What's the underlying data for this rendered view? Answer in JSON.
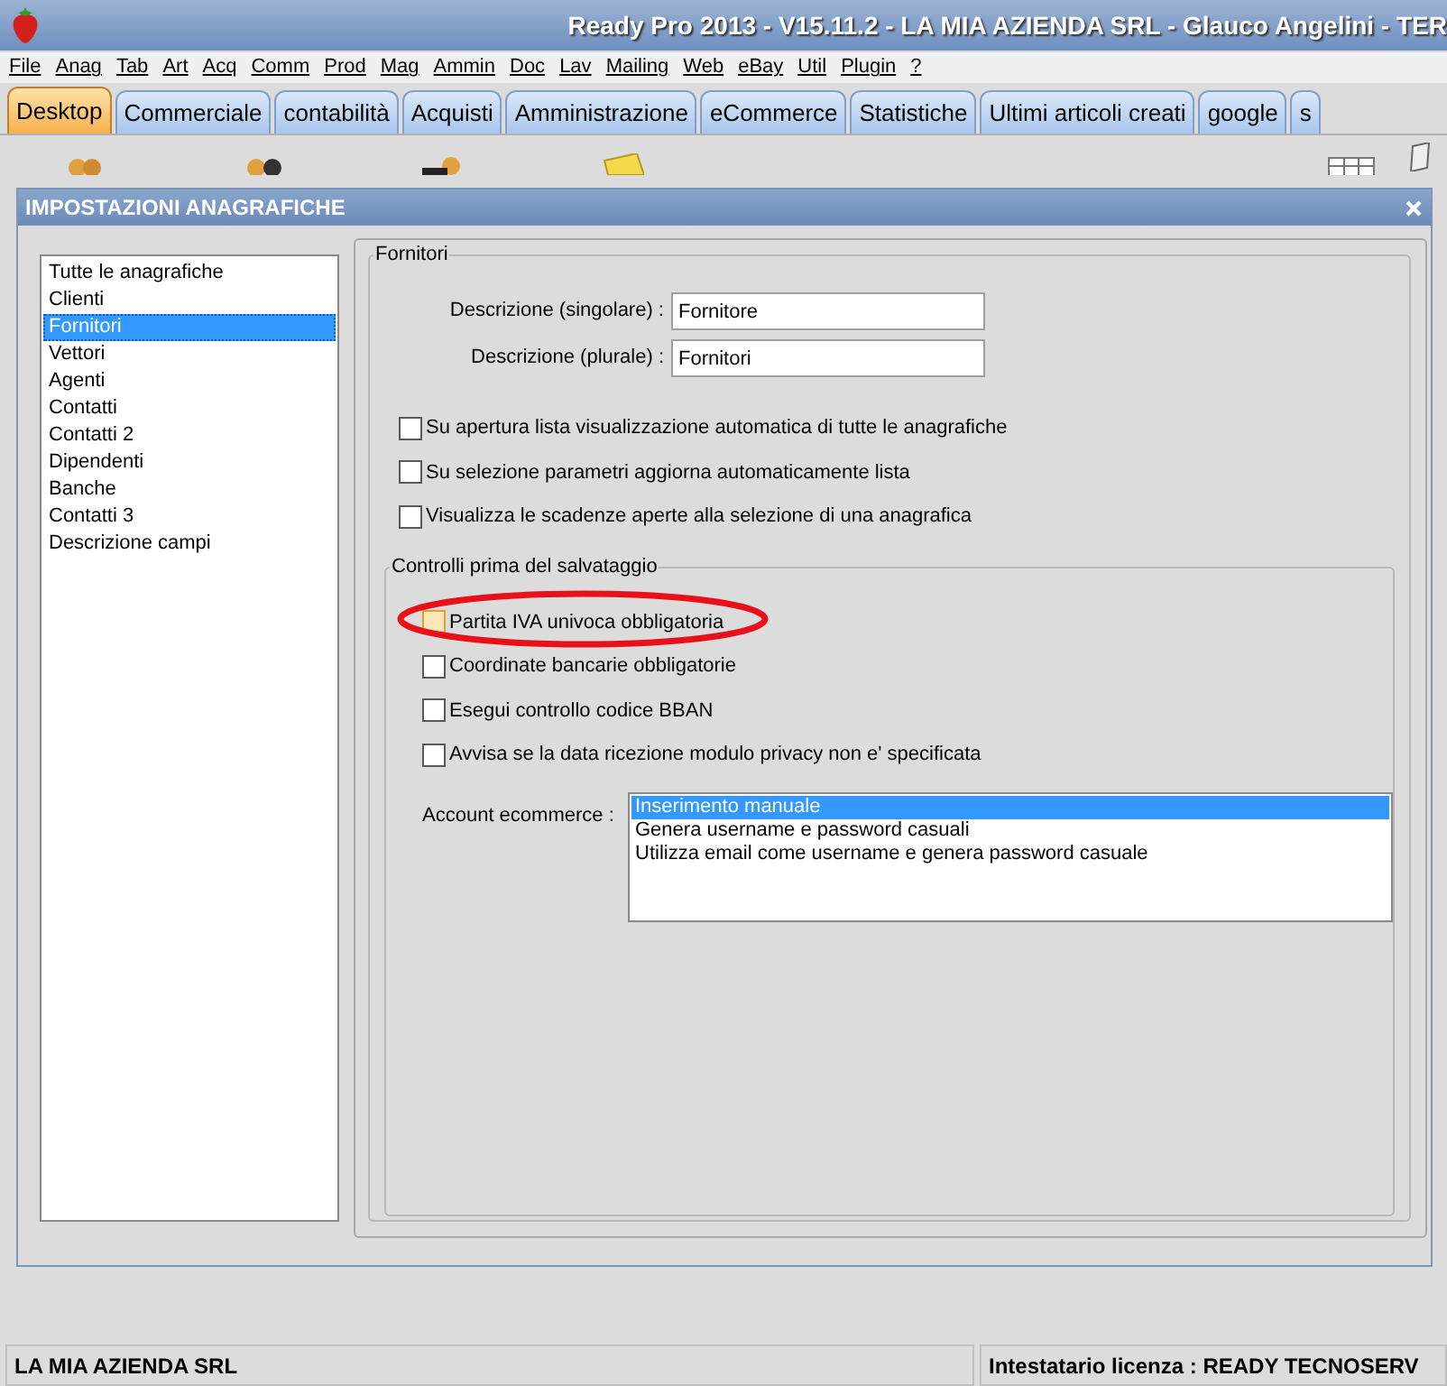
{
  "window": {
    "title": "Ready Pro 2013 - V15.11.2 - LA MIA AZIENDA SRL - Glauco Angelini - TER"
  },
  "menu": [
    "File",
    "Anag",
    "Tab",
    "Art",
    "Acq",
    "Comm",
    "Prod",
    "Mag",
    "Ammin",
    "Doc",
    "Lav",
    "Mailing",
    "Web",
    "eBay",
    "Util",
    "Plugin",
    "?"
  ],
  "tabs": [
    {
      "label": "Desktop",
      "selected": true
    },
    {
      "label": "Commerciale",
      "selected": false
    },
    {
      "label": "contabilità",
      "selected": false
    },
    {
      "label": "Acquisti",
      "selected": false
    },
    {
      "label": "Amministrazione",
      "selected": false
    },
    {
      "label": "eCommerce",
      "selected": false
    },
    {
      "label": "Statistiche",
      "selected": false
    },
    {
      "label": "Ultimi articoli creati",
      "selected": false
    },
    {
      "label": "google",
      "selected": false
    },
    {
      "label": "s",
      "selected": false
    }
  ],
  "dialog": {
    "title": "IMPOSTAZIONI ANAGRAFICHE",
    "list": [
      {
        "label": "Tutte le anagrafiche",
        "selected": false
      },
      {
        "label": "Clienti",
        "selected": false
      },
      {
        "label": "Fornitori",
        "selected": true
      },
      {
        "label": "Vettori",
        "selected": false
      },
      {
        "label": "Agenti",
        "selected": false
      },
      {
        "label": "Contatti",
        "selected": false
      },
      {
        "label": "Contatti 2",
        "selected": false
      },
      {
        "label": "Dipendenti",
        "selected": false
      },
      {
        "label": "Banche",
        "selected": false
      },
      {
        "label": "Contatti 3",
        "selected": false
      },
      {
        "label": "Descrizione campi",
        "selected": false
      }
    ],
    "group": {
      "title": "Fornitori",
      "fields": [
        {
          "label": "Descrizione (singolare) :",
          "value": "Fornitore"
        },
        {
          "label": "Descrizione (plurale) :",
          "value": "Fornitori"
        }
      ],
      "options": [
        {
          "label": "Su apertura lista visualizzazione automatica di tutte le anagrafiche",
          "checked": false
        },
        {
          "label": "Su selezione parametri aggiorna automaticamente lista",
          "checked": false
        },
        {
          "label": "Visualizza le scadenze aperte alla selezione di una anagrafica",
          "checked": false
        }
      ],
      "controls": {
        "title": "Controlli prima del salvataggio",
        "options": [
          {
            "label": "Partita IVA univoca obbligatoria",
            "checked": false,
            "circled": true
          },
          {
            "label": "Coordinate bancarie obbligatorie",
            "checked": false,
            "circled": false
          },
          {
            "label": "Esegui controllo codice BBAN",
            "checked": false,
            "circled": false
          },
          {
            "label": "Avvisa se la data ricezione modulo privacy non e' specificata",
            "checked": false,
            "circled": false
          }
        ],
        "account_label": "Account ecommerce :",
        "account_options": [
          {
            "label": "Inserimento manuale",
            "selected": true
          },
          {
            "label": "Genera username e password casuali",
            "selected": false
          },
          {
            "label": "Utilizza email come username e genera password casuale",
            "selected": false
          }
        ]
      }
    }
  },
  "status_bar": {
    "company": "LA MIA AZIENDA SRL",
    "license": "Intestatario licenza : READY TECNOSERV"
  }
}
